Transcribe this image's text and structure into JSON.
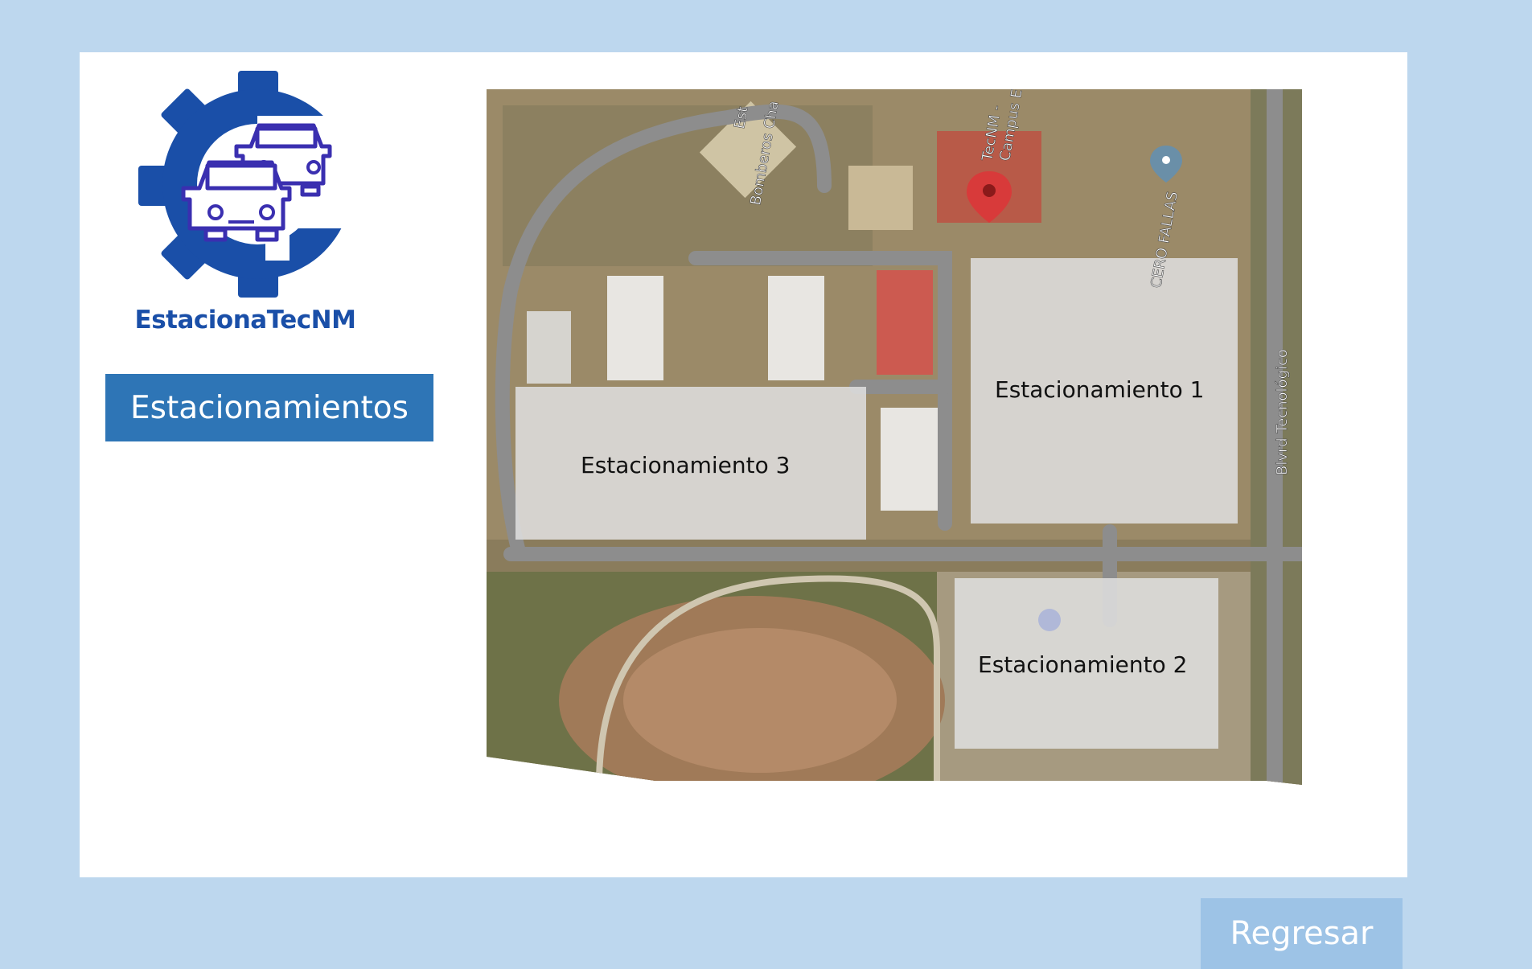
{
  "app": {
    "logo_text": "EstacionaTecNM",
    "logo_icon": "gear-with-cars-icon",
    "brand_color": "#1a4fa8"
  },
  "sidebar": {
    "estacionamientos_label": "Estacionamientos"
  },
  "map": {
    "lots": [
      {
        "label": "Estacionamiento 1"
      },
      {
        "label": "Estacionamiento 2"
      },
      {
        "label": "Estacionamiento 3"
      }
    ],
    "streets": {
      "blvd": "Blvrd Tecnológico",
      "bomberos": "Bomberos Cha",
      "bomberos_top": "Est",
      "cerofallas": "CERO FALLAS",
      "tecnm": "TecNM -",
      "campus": "Campus E"
    }
  },
  "footer": {
    "regresar_label": "Regresar"
  },
  "colors": {
    "page_bg": "#bdd7ee",
    "primary_button": "#2e75b6",
    "secondary_button": "#9dc3e6"
  }
}
